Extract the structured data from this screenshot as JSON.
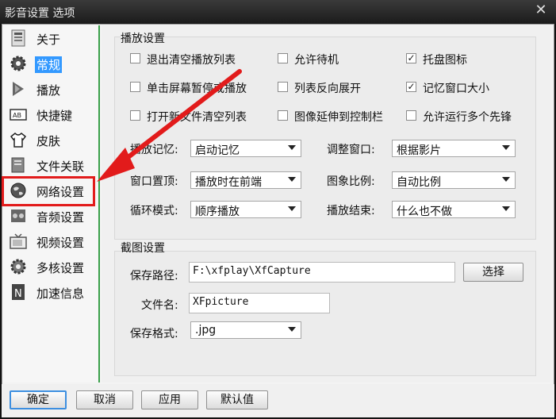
{
  "window": {
    "title": "影音设置 选项",
    "close_glyph": "✕"
  },
  "sidebar": {
    "items": [
      {
        "label": "关于",
        "icon": "info-icon"
      },
      {
        "label": "常规",
        "icon": "gear-icon",
        "selected": true
      },
      {
        "label": "播放",
        "icon": "play-icon"
      },
      {
        "label": "快捷键",
        "icon": "keyboard-icon"
      },
      {
        "label": "皮肤",
        "icon": "shirt-icon"
      },
      {
        "label": "文件关联",
        "icon": "file-icon"
      },
      {
        "label": "网络设置",
        "icon": "globe-icon"
      },
      {
        "label": "音频设置",
        "icon": "audio-icon"
      },
      {
        "label": "视频设置",
        "icon": "tv-icon"
      },
      {
        "label": "多核设置",
        "icon": "cpu-icon"
      },
      {
        "label": "加速信息",
        "icon": "book-icon"
      }
    ]
  },
  "playback": {
    "title": "播放设置",
    "checkboxes": [
      {
        "label": "退出清空播放列表",
        "checked": false
      },
      {
        "label": "允许待机",
        "checked": false
      },
      {
        "label": "托盘图标",
        "checked": true
      },
      {
        "label": "单击屏幕暂停或播放",
        "checked": false
      },
      {
        "label": "列表反向展开",
        "checked": false
      },
      {
        "label": "记忆窗口大小",
        "checked": true
      },
      {
        "label": "打开新文件清空列表",
        "checked": false
      },
      {
        "label": "图像延伸到控制栏",
        "checked": false
      },
      {
        "label": "允许运行多个先锋",
        "checked": false
      }
    ],
    "combos": [
      {
        "label": "播放记忆:",
        "value": "启动记忆"
      },
      {
        "label": "调整窗口:",
        "value": "根据影片"
      },
      {
        "label": "窗口置顶:",
        "value": "播放时在前端"
      },
      {
        "label": "图象比例:",
        "value": "自动比例"
      },
      {
        "label": "循环模式:",
        "value": "顺序播放"
      },
      {
        "label": "播放结束:",
        "value": "什么也不做"
      }
    ]
  },
  "capture": {
    "title": "截图设置",
    "path_label": "保存路径:",
    "path_value": "F:\\xfplay\\XfCapture",
    "browse_label": "选择",
    "filename_label": "文件名:",
    "filename_value": "XFpicture",
    "format_label": "保存格式:",
    "format_value": ".jpg"
  },
  "buttons": {
    "ok": "确定",
    "cancel": "取消",
    "apply": "应用",
    "default": "默认值"
  },
  "annotation": {
    "color": "#e21b1b"
  }
}
